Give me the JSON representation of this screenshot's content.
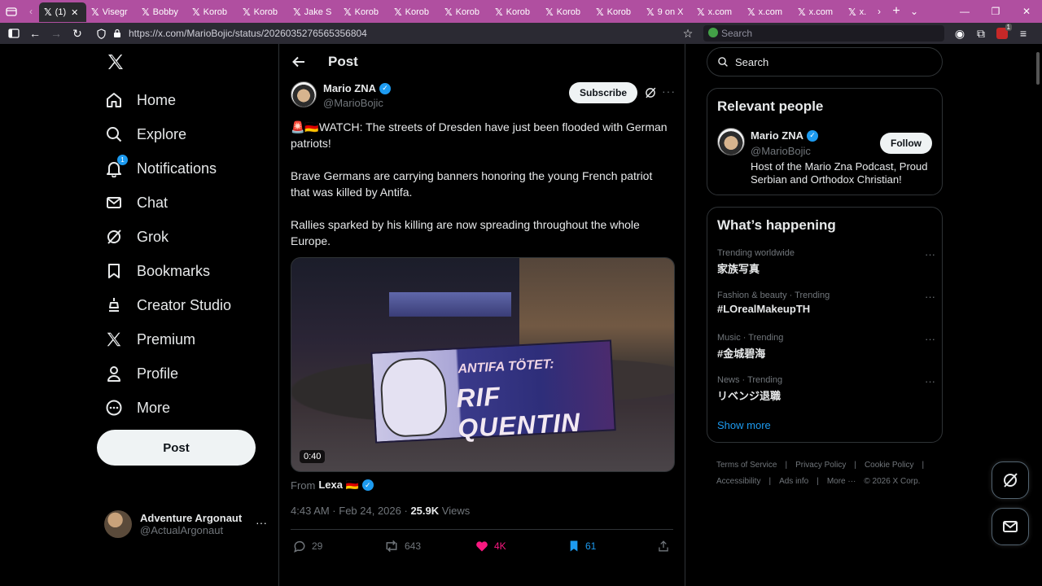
{
  "browser": {
    "tabs": [
      {
        "label": "(1)",
        "active": true
      },
      {
        "label": "Visegr"
      },
      {
        "label": "Bobby"
      },
      {
        "label": "Korob"
      },
      {
        "label": "Korob"
      },
      {
        "label": "Jake S"
      },
      {
        "label": "Korob"
      },
      {
        "label": "Korob"
      },
      {
        "label": "Korob"
      },
      {
        "label": "Korob"
      },
      {
        "label": "Korob"
      },
      {
        "label": "Korob"
      },
      {
        "label": "9 on X"
      },
      {
        "label": "x.com"
      },
      {
        "label": "x.com"
      },
      {
        "label": "x.com"
      },
      {
        "label": "x."
      }
    ],
    "url": "https://x.com/MarioBojic/status/2026035276565356804",
    "search_placeholder": "Search",
    "extension_badge": "1"
  },
  "sidebar": {
    "items": [
      {
        "label": "Home",
        "icon": "home-icon"
      },
      {
        "label": "Explore",
        "icon": "search-icon"
      },
      {
        "label": "Notifications",
        "icon": "bell-icon",
        "badge": "1"
      },
      {
        "label": "Chat",
        "icon": "mail-icon"
      },
      {
        "label": "Grok",
        "icon": "grok-icon"
      },
      {
        "label": "Bookmarks",
        "icon": "bookmark-icon"
      },
      {
        "label": "Creator Studio",
        "icon": "creator-icon"
      },
      {
        "label": "Premium",
        "icon": "x-icon"
      },
      {
        "label": "Profile",
        "icon": "person-icon"
      },
      {
        "label": "More",
        "icon": "more-circle-icon"
      }
    ],
    "post_button": "Post",
    "account": {
      "name": "Adventure Argonaut",
      "handle": "@ActualArgonaut"
    }
  },
  "main": {
    "title": "Post",
    "author": {
      "name": "Mario ZNA",
      "handle": "@MarioBojic"
    },
    "subscribe_label": "Subscribe",
    "text": {
      "p1": "🚨🇩🇪WATCH: The streets of Dresden have just been flooded with German patriots!",
      "p2": "Brave Germans are carrying banners honoring the young French patriot that was killed by Antifa.",
      "p3": "Rallies sparked by his killing are now spreading throughout the whole Europe."
    },
    "video": {
      "duration": "0:40",
      "banner_top": "ANTIFA TÖTET:",
      "banner_main": "RIF QUENTIN"
    },
    "from_label": "From",
    "from_user": "Lexa 🇩🇪",
    "timestamp": "4:43 AM · Feb 24, 2026 ·",
    "views_count": "25.9K",
    "views_label": "Views",
    "stats": {
      "replies": "29",
      "reposts": "643",
      "likes": "4K",
      "bookmarks": "61"
    }
  },
  "right": {
    "search_placeholder": "Search",
    "relevant": {
      "title": "Relevant people",
      "name": "Mario ZNA",
      "handle": "@MarioBojic",
      "follow_label": "Follow",
      "bio": "Host of the Mario Zna Podcast, Proud Serbian and Orthodox Christian!"
    },
    "happening": {
      "title": "What’s happening",
      "trends": [
        {
          "category": "Trending worldwide",
          "name": "家族写真"
        },
        {
          "category": "Fashion & beauty · Trending",
          "name": "#LOrealMakeupTH"
        },
        {
          "category": "Music · Trending",
          "name": "#金城碧海"
        },
        {
          "category": "News · Trending",
          "name": "リベンジ退職"
        }
      ],
      "show_more": "Show more"
    },
    "footer": {
      "terms": "Terms of Service",
      "privacy": "Privacy Policy",
      "cookie": "Cookie Policy",
      "accessibility": "Accessibility",
      "ads": "Ads info",
      "more": "More ···",
      "copyright": "© 2026 X Corp."
    }
  },
  "colors": {
    "accent": "#1d9bf0",
    "like": "#f91880",
    "tabbar": "#b04fa0",
    "background": "#000000"
  }
}
